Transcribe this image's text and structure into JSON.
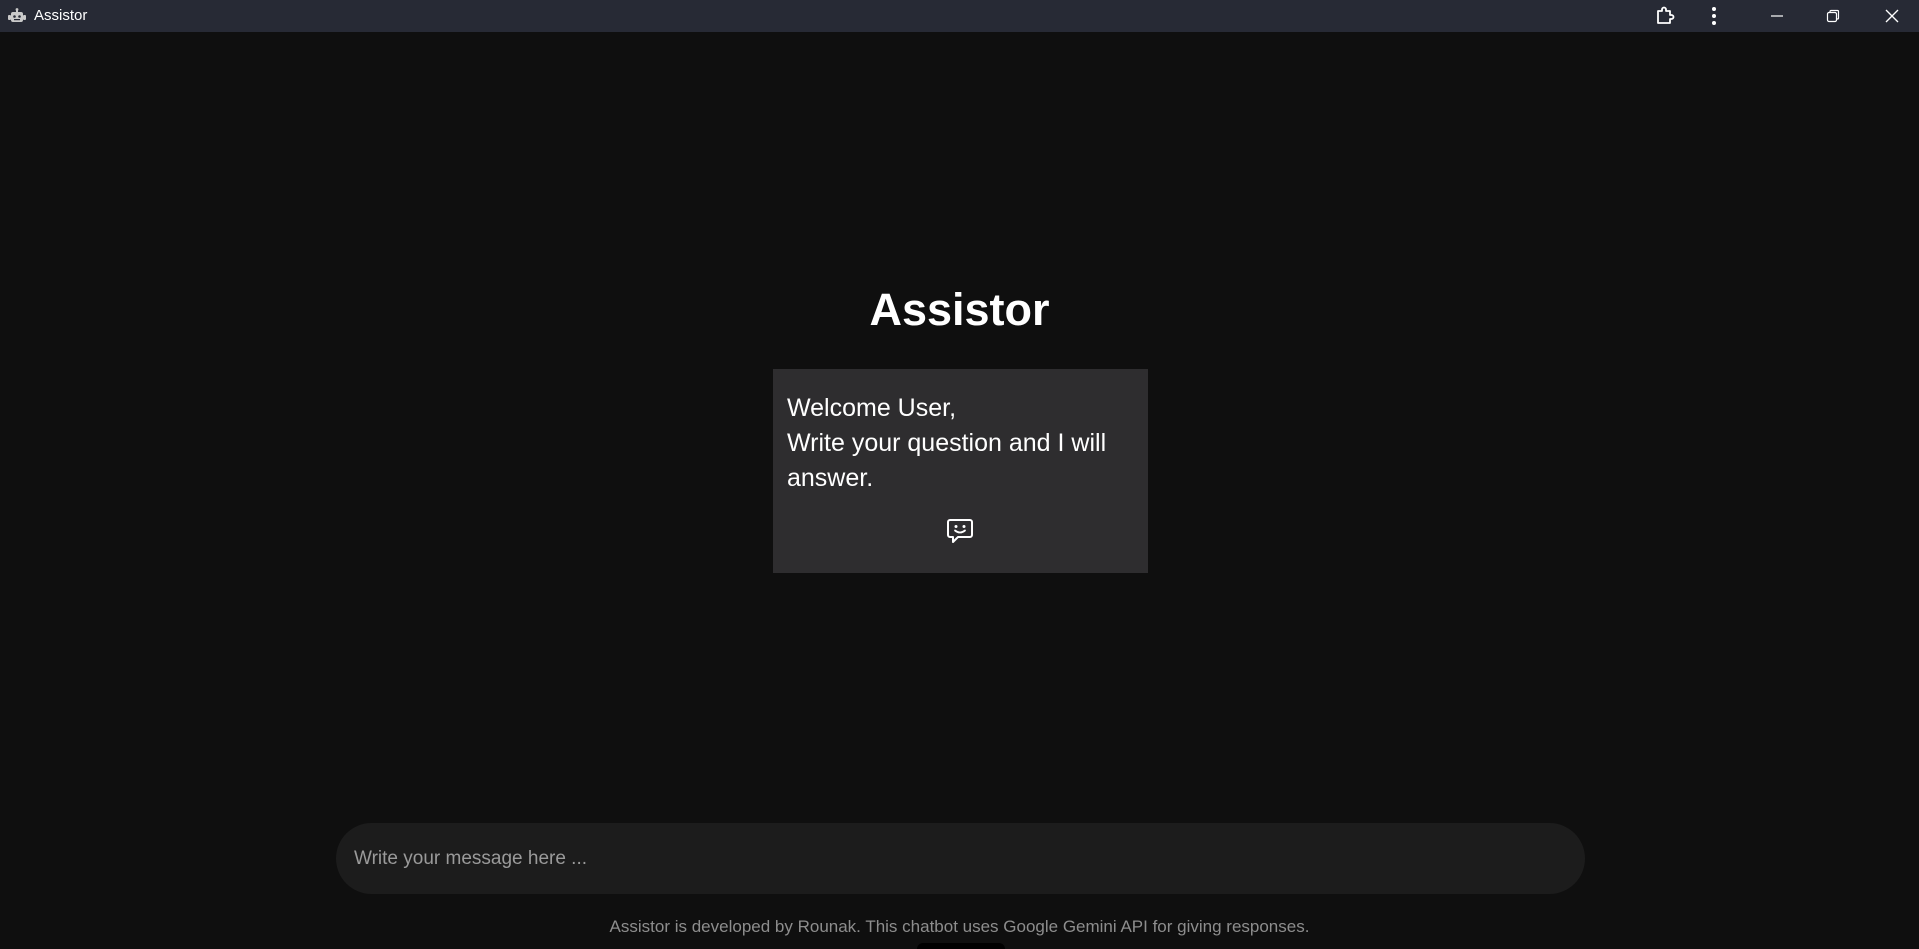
{
  "window": {
    "title": "Assistor",
    "icons": {
      "app": "robot-icon",
      "extension": "puzzle-piece-icon",
      "more": "more-vertical-icon",
      "minimize": "minimize-icon",
      "maximize": "restore-icon",
      "close": "close-icon"
    }
  },
  "main": {
    "title": "Assistor",
    "welcome": {
      "line1": "Welcome User,",
      "line2": "Write your question and I will answer.",
      "icon": "chat-smile-icon"
    }
  },
  "composer": {
    "placeholder": "Write your message here ...",
    "value": ""
  },
  "footer": {
    "note": "Assistor is developed by Rounak. This chatbot uses Google Gemini API for giving responses."
  },
  "colors": {
    "background": "#0f0f0f",
    "titlebar": "#272a35",
    "card": "#2e2d2f",
    "input": "#1c1c1c",
    "text": "#ffffff",
    "muted": "#8d8d8d"
  }
}
